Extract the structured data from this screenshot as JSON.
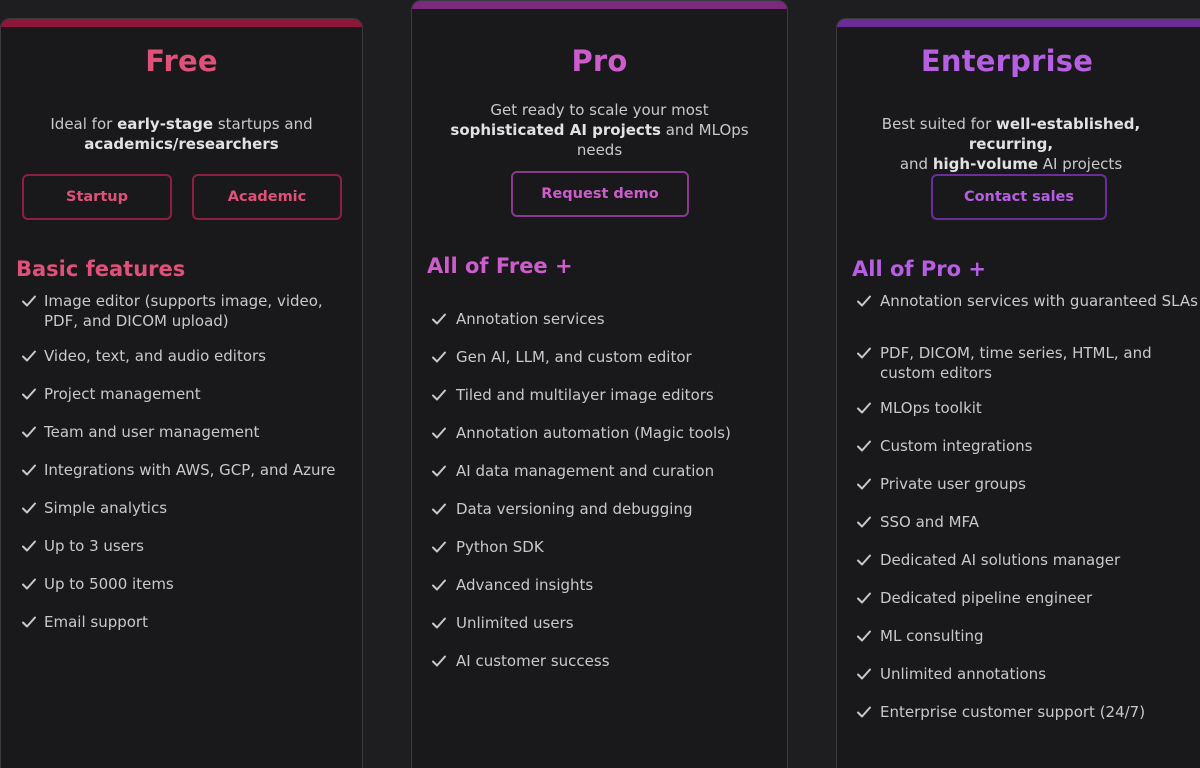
{
  "colors": {
    "free_accent": "#e0517a",
    "pro_accent": "#cf5ccd",
    "enterprise_accent": "#b75fe3",
    "free_bar": "#8e1638",
    "pro_bar": "#7b2a7e",
    "enterprise_bar": "#6b2c97"
  },
  "free": {
    "title": "Free",
    "desc": [
      "Ideal for ",
      "early-stage",
      " startups and ",
      "academics/researchers",
      ""
    ],
    "buttons": [
      "Startup",
      "Academic"
    ],
    "section": "Basic features",
    "features": [
      "Image editor (supports image, video, PDF, and DICOM upload)",
      "Video, text, and audio editors",
      "Project management",
      "Team and user management",
      "Integrations with AWS, GCP, and Azure",
      "Simple analytics",
      "Up to 3 users",
      "Up to 5000 items",
      "Email support"
    ]
  },
  "pro": {
    "title": "Pro",
    "desc": [
      "Get ready to scale your most ",
      "sophisticated AI projects",
      " and MLOps needs",
      "",
      ""
    ],
    "button": "Request demo",
    "section": "All of Free +",
    "features": [
      "Annotation services",
      "Gen AI, LLM, and custom editor",
      "Tiled and multilayer image editors",
      "Annotation automation (Magic tools)",
      "AI data management and curation",
      "Data versioning and debugging",
      "Python SDK",
      "Advanced insights",
      "Unlimited users",
      "AI customer success"
    ]
  },
  "enterprise": {
    "title": "Enterprise",
    "desc": [
      "Best suited for ",
      "well-established, recurring,",
      " and ",
      "high-volume",
      " AI projects"
    ],
    "button": "Contact sales",
    "section": "All of Pro +",
    "features": [
      "Annotation services with guaranteed SLAs",
      "PDF, DICOM, time series, HTML, and custom editors",
      "MLOps toolkit",
      "Custom integrations",
      "Private user groups",
      "SSO and MFA",
      "Dedicated AI solutions manager",
      "Dedicated pipeline engineer",
      "ML consulting",
      "Unlimited annotations",
      "Enterprise customer support (24/7)"
    ]
  }
}
